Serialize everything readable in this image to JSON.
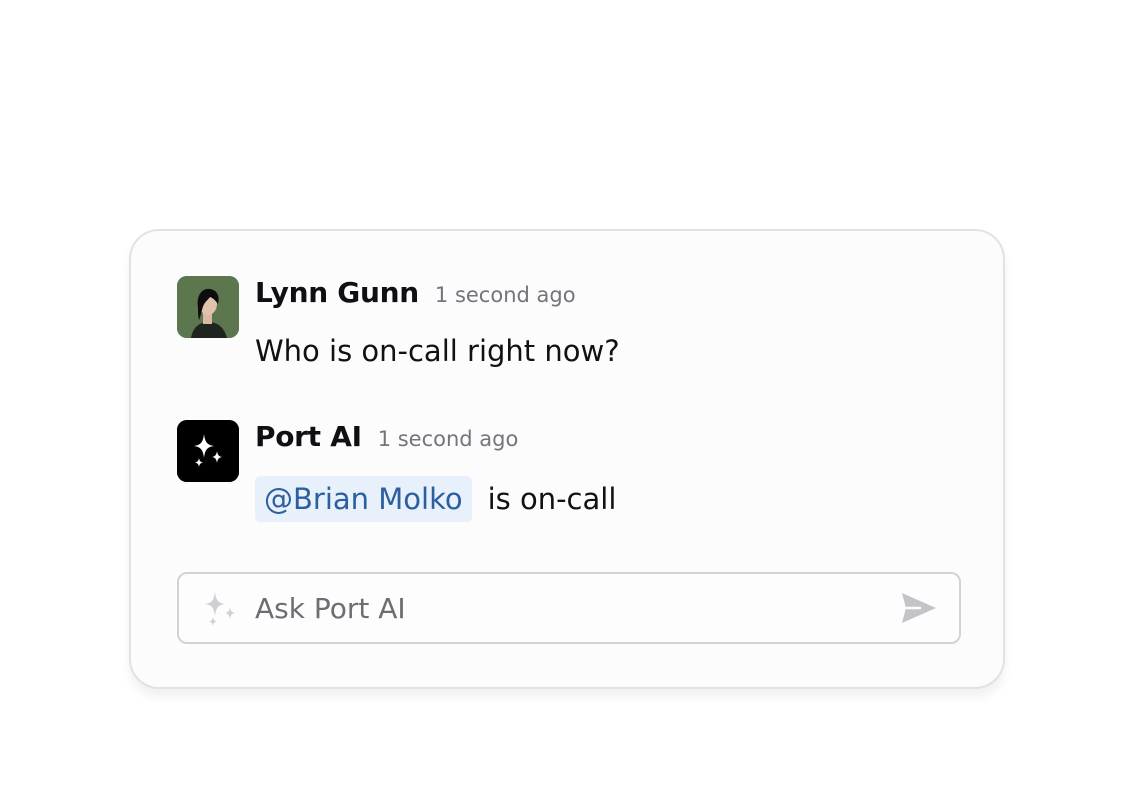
{
  "messages": [
    {
      "author": "Lynn Gunn",
      "time": "1 second ago",
      "text": "Who is on-call right now?",
      "avatar": "user-photo"
    },
    {
      "author": "Port AI",
      "time": "1 second ago",
      "mention": "@Brian Molko",
      "text": "is on-call",
      "avatar": "sparkle-icon"
    }
  ],
  "composer": {
    "placeholder": "Ask Port AI",
    "leading_icon": "sparkle-icon",
    "send_icon": "send-icon"
  },
  "colors": {
    "mention_bg": "#e7f0fb",
    "mention_text": "#2c5f9e",
    "bot_avatar_bg": "#000000"
  }
}
